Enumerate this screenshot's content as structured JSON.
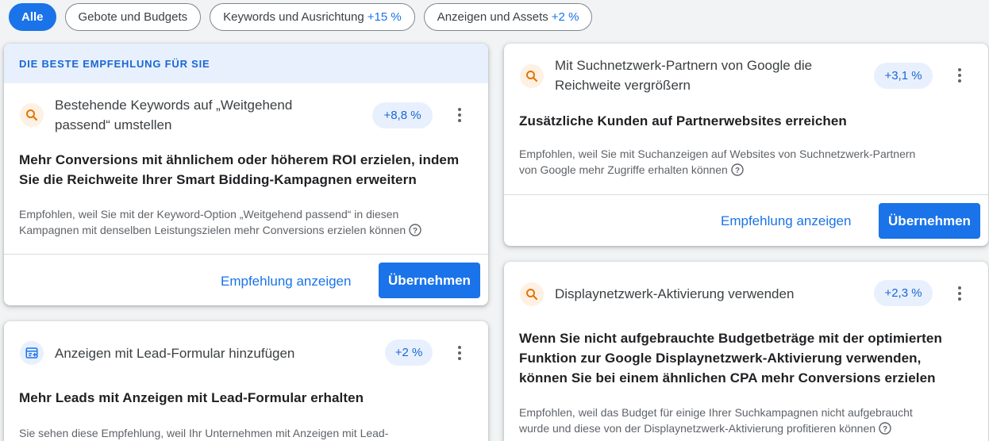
{
  "chips": [
    {
      "label": "Alle",
      "delta": ""
    },
    {
      "label": "Gebote und Budgets",
      "delta": ""
    },
    {
      "label": "Keywords und Ausrichtung",
      "delta": "+15 %"
    },
    {
      "label": "Anzeigen und Assets",
      "delta": "+2 %"
    }
  ],
  "card1": {
    "banner": "DIE BESTE EMPFEHLUNG FÜR SIE",
    "title_line1": "Bestehende Keywords auf „Weitgehend",
    "title_line2": "passend“ umstellen",
    "uplift": "+8,8 %",
    "headline_line1": "Mehr Conversions mit ähnlichem oder höherem ROI erzielen, indem",
    "headline_line2": "Sie die Reichweite Ihrer Smart Bidding-Kampagnen erweitern",
    "reason_line1": "Empfohlen, weil Sie mit der Keyword-Option „Weitgehend passend“ in diesen",
    "reason_line2": "Kampagnen mit denselben Leistungszielen mehr Conversions erzielen können",
    "view_label": "Empfehlung anzeigen",
    "apply_label": "Übernehmen"
  },
  "card2": {
    "title": "Anzeigen mit Lead-Formular hinzufügen",
    "uplift": "+2 %",
    "headline": "Mehr Leads mit Anzeigen mit Lead-Formular erhalten",
    "reason_line1": "Sie sehen diese Empfehlung, weil Ihr Unternehmen mit Anzeigen mit Lead-"
  },
  "card3": {
    "title_line1": "Mit Suchnetzwerk-Partnern von Google die",
    "title_line2": "Reichweite vergrößern",
    "uplift": "+3,1 %",
    "headline": "Zusätzliche Kunden auf Partnerwebsites erreichen",
    "reason_line1": "Empfohlen, weil Sie mit Suchanzeigen auf Websites von Suchnetzwerk-Partnern",
    "reason_line2": "von Google mehr Zugriffe erhalten können",
    "view_label": "Empfehlung anzeigen",
    "apply_label": "Übernehmen"
  },
  "card4": {
    "title": "Displaynetzwerk-Aktivierung verwenden",
    "uplift": "+2,3 %",
    "headline_line1": "Wenn Sie nicht aufgebrauchte Budgetbeträge mit der optimierten",
    "headline_line2": "Funktion zur Google Displaynetzwerk-Aktivierung verwenden,",
    "headline_line3": "können Sie bei einem ähnlichen CPA mehr Conversions erzielen",
    "reason_line1": "Empfohlen, weil das Budget für einige Ihrer Suchkampagnen nicht aufgebraucht",
    "reason_line2": "wurde und diese von der Displaynetzwerk-Aktivierung profitieren können"
  },
  "icons": {
    "search": "search-icon",
    "lead_form": "lead-form-icon",
    "more": "more-vert-icon",
    "help": "help-icon"
  },
  "colors": {
    "accent": "#1a73e8",
    "banner_bg": "#e8f0fe",
    "search_icon": "#e37400"
  }
}
